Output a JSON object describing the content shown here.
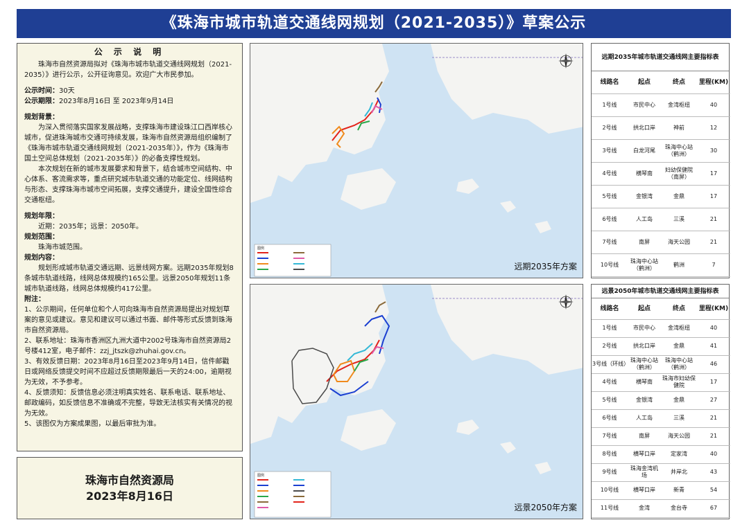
{
  "title": "《珠海市城市轨道交通线网规划（2021-2035）》草案公示",
  "notice": {
    "heading": "公 示 说 明",
    "intro": "珠海市自然资源局拟对《珠海市城市轨道交通线网规划（2021-2035）》进行公示，公开征询意见。欢迎广大市民参加。",
    "period_label": "公示时间：",
    "period_value": "30天",
    "deadline_label": "公示期限：",
    "deadline_value": "2023年8月16日 至 2023年9月14日",
    "background_label": "规划背景：",
    "background_p1": "为深入贯彻落实国家发展战略，支撑珠海市建设珠江口西岸核心城市，促进珠海城市交通可持续发展，珠海市自然资源局组织编制了《珠海市城市轨道交通线网规划（2021-2035年）》，作为《珠海市国土空间总体规划（2021-2035年）》的必备支撑性规划。",
    "background_p2": "本次规划在新的城市发展要求和背景下，结合城市空间结构、中心体系、客流需求等，重点研究城市轨道交通的功能定位、线网结构与形态、支撑珠海市城市空间拓展，支撑交通提升，建设全国性综合交通枢纽。",
    "years_label": "规划年限：",
    "years_value": "近期：2035年；远景：2050年。",
    "scope_label": "规划范围：",
    "scope_value": "珠海市城范围。",
    "content_label": "规划内容：",
    "content_value": "规划形成城市轨道交通远期、远景线网方案。远期2035年规划8条城市轨道线路，线网总体规模约165公里。远景2050年规划11条城市轨道线路，线网总体规模约417公里。",
    "notes_label": "附注：",
    "note1": "1、公示期间，任何单位和个人可向珠海市自然资源局提出对规划草案的意见或建议。意见和建议可以通过书面、邮件等形式反馈到珠海市自然资源局。",
    "note2": "2、联系地址：珠海市香洲区九洲大道中2002号珠海市自然资源局2号楼412室，电子邮件：zzj_jtszk@zhuhai.gov.cn。",
    "note3": "3、有效反馈日期：2023年8月16日至2023年9月14日，信件邮戳日或网络反馈提交时间不应超过反馈期限最后一天的24:00，逾期视为无效，不予参考。",
    "note4": "4、反馈须知：反馈信息必须注明真实姓名、联系电话、联系地址、邮政编码，如反馈信息不准确或不完整，导致无法核实有关情况的视为无效。",
    "note5": "5、该图仅为方案成果图，以最后审批为准。"
  },
  "sign": {
    "org": "珠海市自然资源局",
    "date": "2023年8月16日"
  },
  "maps": {
    "near_caption": "远期2035年方案",
    "far_caption": "远景2050年方案",
    "legend_title": "图例",
    "colors": {
      "sea": "#cfe3f3",
      "land": "#f4f4f2",
      "line1": "#e2231a",
      "line2": "#1a3fd1",
      "line3": "#f08a1c",
      "line4": "#2aa84a",
      "line5": "#8a6a3a",
      "line6": "#e05aa8",
      "line7": "#33b8d6",
      "line10": "#4a4a4a"
    }
  },
  "table_near": {
    "caption": "远期2035年城市轨道交通线网主要指标表",
    "headers": [
      "线路名",
      "起点",
      "终点",
      "里程(KM)"
    ],
    "rows": [
      [
        "1号线",
        "市民中心",
        "金湾枢纽",
        "40"
      ],
      [
        "2号线",
        "拱北口岸",
        "神前",
        "12"
      ],
      [
        "3号线",
        "白龙河尾",
        "珠海中心站（鹤洲）",
        "30"
      ],
      [
        "4号线",
        "横琴南",
        "妇幼保健院（南屏）",
        "17"
      ],
      [
        "5号线",
        "金银湾",
        "金鼎",
        "17"
      ],
      [
        "6号线",
        "人工岛",
        "三溪",
        "21"
      ],
      [
        "7号线",
        "南屏",
        "海天公园",
        "21"
      ],
      [
        "10号线",
        "珠海中心站（鹤洲）",
        "鹤洲",
        "7"
      ]
    ]
  },
  "table_far": {
    "caption": "远景2050年城市轨道交通线网主要指标表",
    "headers": [
      "线路名",
      "起点",
      "终点",
      "里程(KM)"
    ],
    "rows": [
      [
        "1号线",
        "市民中心",
        "金湾枢纽",
        "40"
      ],
      [
        "2号线",
        "拱北口岸",
        "金鼎",
        "41"
      ],
      [
        "3号线（环线）",
        "珠海中心站（鹤洲）",
        "珠海中心站（鹤洲）",
        "46"
      ],
      [
        "4号线",
        "横琴南",
        "珠海市妇幼保健院",
        "17"
      ],
      [
        "5号线",
        "金银湾",
        "金鼎",
        "27"
      ],
      [
        "6号线",
        "人工岛",
        "三溪",
        "21"
      ],
      [
        "7号线",
        "南屏",
        "海天公园",
        "21"
      ],
      [
        "8号线",
        "横琴口岸",
        "定家湾",
        "40"
      ],
      [
        "9号线",
        "珠海金湾机场",
        "井岸北",
        "43"
      ],
      [
        "10号线",
        "横琴口岸",
        "新青",
        "54"
      ],
      [
        "11号线",
        "金湾",
        "金台寺",
        "67"
      ]
    ]
  }
}
